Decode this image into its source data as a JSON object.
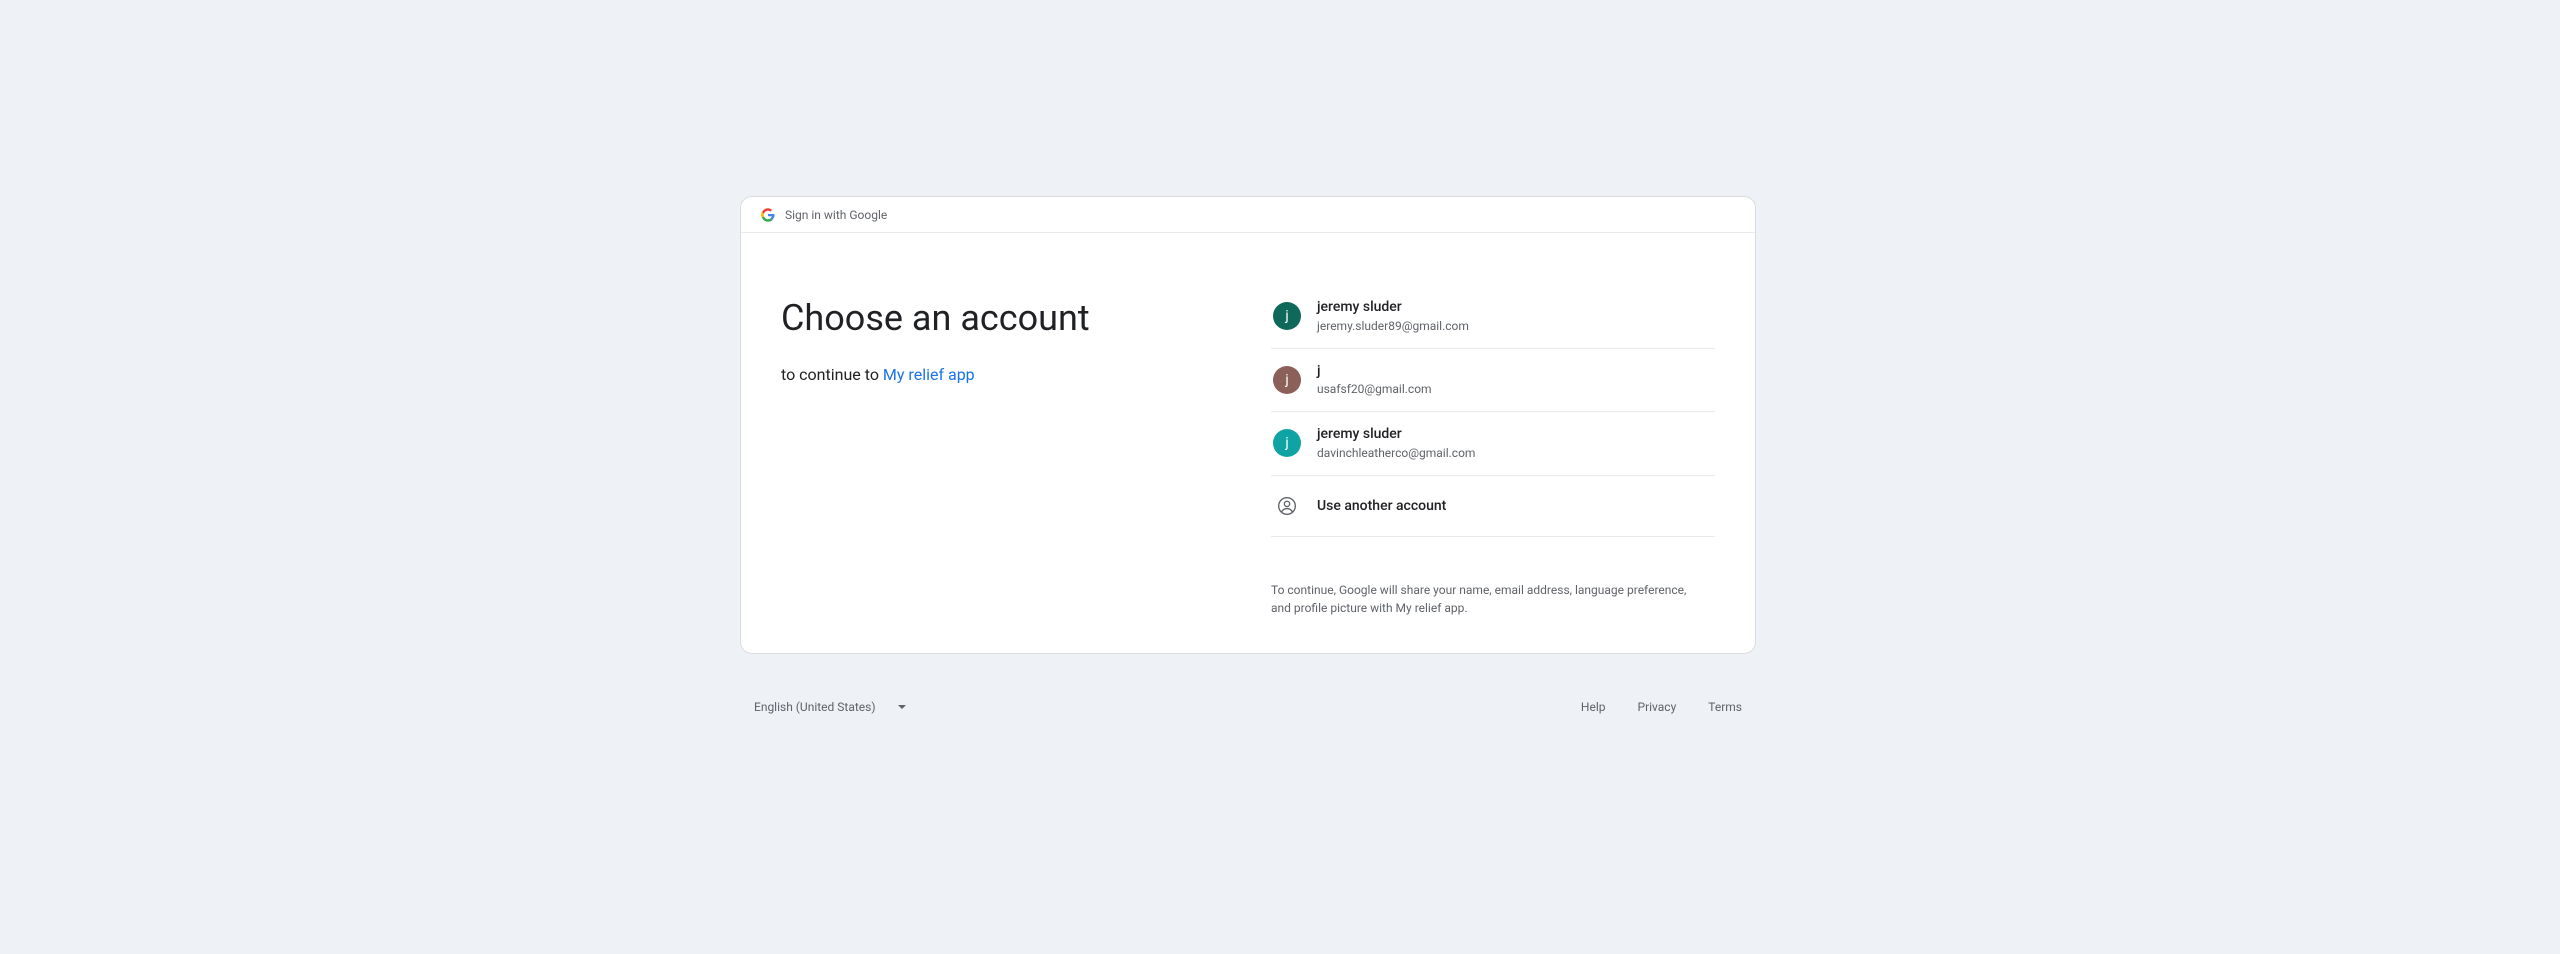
{
  "header": {
    "label": "Sign in with Google"
  },
  "main": {
    "heading": "Choose an account",
    "subheading_prefix": "to continue to ",
    "app_name": "My relief app"
  },
  "accounts": [
    {
      "name": "jeremy sluder",
      "email": "jeremy.sluder89@gmail.com",
      "initial": "j",
      "bg": "#0f695a"
    },
    {
      "name": "j",
      "email": "usafsf20@gmail.com",
      "initial": "j",
      "bg": "#8a6059"
    },
    {
      "name": "jeremy sluder",
      "email": "davinchleatherco@gmail.com",
      "initial": "j",
      "bg": "#0fa3a3"
    }
  ],
  "use_another_label": "Use another account",
  "disclosure": "To continue, Google will share your name, email address, language preference, and profile picture with My relief app.",
  "footer": {
    "language": "English (United States)",
    "links": {
      "help": "Help",
      "privacy": "Privacy",
      "terms": "Terms"
    }
  }
}
